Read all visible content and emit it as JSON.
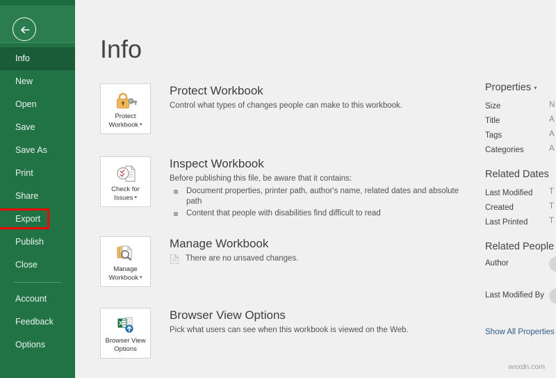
{
  "rail": {
    "back_icon": "back-arrow-icon",
    "items": [
      {
        "label": "Info",
        "state": "selected"
      },
      {
        "label": "New",
        "state": "normal"
      },
      {
        "label": "Open",
        "state": "normal"
      },
      {
        "label": "Save",
        "state": "normal"
      },
      {
        "label": "Save As",
        "state": "normal"
      },
      {
        "label": "Print",
        "state": "normal"
      },
      {
        "label": "Share",
        "state": "normal"
      },
      {
        "label": "Export",
        "state": "highlighted"
      },
      {
        "label": "Publish",
        "state": "normal"
      },
      {
        "label": "Close",
        "state": "normal"
      },
      {
        "label": "",
        "state": "divider"
      },
      {
        "label": "Account",
        "state": "normal"
      },
      {
        "label": "Feedback",
        "state": "normal"
      },
      {
        "label": "Options",
        "state": "normal"
      }
    ],
    "highlight_color": "#ff0000",
    "background_color": "#217346"
  },
  "main": {
    "page_title": "Info",
    "sections": [
      {
        "tile_label": "Protect\nWorkbook",
        "tile_has_caret": true,
        "tile_icon": "lock-key-icon",
        "heading": "Protect Workbook",
        "desc": "Control what types of changes people can make to this workbook."
      },
      {
        "tile_label": "Check for\nIssues",
        "tile_has_caret": true,
        "tile_icon": "document-checklist-icon",
        "heading": "Inspect Workbook",
        "desc": "Before publishing this file, be aware that it contains:",
        "bullets": [
          "Document properties, printer path, author's name, related dates and absolute path",
          "Content that people with disabilities find difficult to read"
        ]
      },
      {
        "tile_label": "Manage\nWorkbook",
        "tile_has_caret": true,
        "tile_icon": "documents-magnifier-icon",
        "heading": "Manage Workbook",
        "note_icon": "unsaved-document-icon",
        "note": "There are no unsaved changes."
      },
      {
        "tile_label": "Browser View\nOptions",
        "tile_has_caret": false,
        "tile_icon": "excel-browser-upload-icon",
        "heading": "Browser View Options",
        "desc": "Pick what users can see when this workbook is viewed on the Web."
      }
    ]
  },
  "properties": {
    "title": "Properties",
    "rows": [
      {
        "name": "Size",
        "value": "N"
      },
      {
        "name": "Title",
        "value": "A"
      },
      {
        "name": "Tags",
        "value": "A"
      },
      {
        "name": "Categories",
        "value": "A"
      }
    ],
    "related_dates_title": "Related Dates",
    "dates": [
      {
        "name": "Last Modified",
        "value": "T"
      },
      {
        "name": "Created",
        "value": "T"
      },
      {
        "name": "Last Printed",
        "value": "T"
      }
    ],
    "related_people_title": "Related People",
    "people": [
      {
        "name": "Author",
        "avatar": "avatar-placeholder"
      },
      {
        "name": "Last Modified By",
        "avatar": "avatar-placeholder"
      }
    ],
    "show_all_link": "Show All Properties"
  },
  "watermark": "wsxdn.com"
}
